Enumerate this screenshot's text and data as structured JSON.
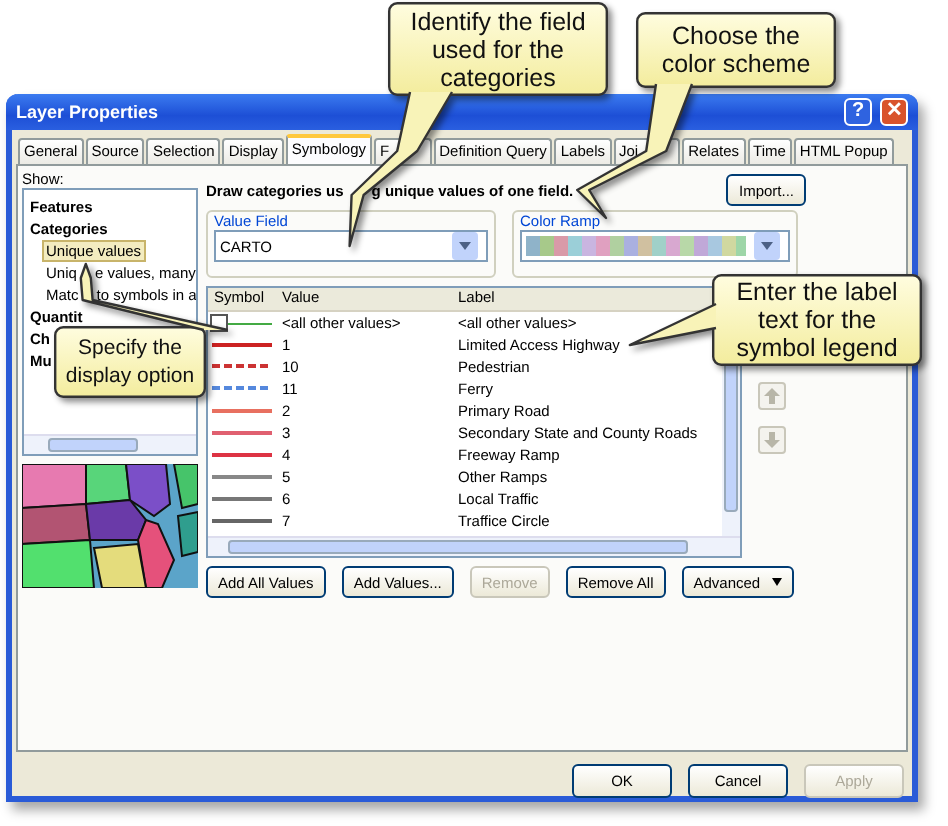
{
  "window": {
    "title": "Layer Properties",
    "help": "?",
    "close": "✕"
  },
  "tabs": [
    {
      "label": "General",
      "selected": false
    },
    {
      "label": "Source",
      "selected": false
    },
    {
      "label": "Selection",
      "selected": false
    },
    {
      "label": "Display",
      "selected": false
    },
    {
      "label": "Symbology",
      "selected": true
    },
    {
      "label": "F",
      "selected": false,
      "covered_by_callout": true
    },
    {
      "label": "Definition Query",
      "selected": false
    },
    {
      "label": "Labels",
      "selected": false
    },
    {
      "label": "Joi",
      "selected": false,
      "covered_by_callout": true
    },
    {
      "label": "Relates",
      "selected": false
    },
    {
      "label": "Time",
      "selected": false
    },
    {
      "label": "HTML Popup",
      "selected": false
    }
  ],
  "show": {
    "label": "Show:",
    "tree": [
      {
        "label": "Features",
        "selected": false
      },
      {
        "label": "Categories",
        "selected": false,
        "children": [
          {
            "label": "Unique values",
            "selected": true
          },
          {
            "label_parts": [
              "Uniq",
              "e values, many"
            ],
            "selected": false
          },
          {
            "label_parts": [
              "Matc",
              "to symbols in a"
            ],
            "selected": false
          }
        ]
      },
      {
        "label": "Quantit",
        "selected": false
      },
      {
        "label": "Ch",
        "selected": false
      },
      {
        "label": "Mu",
        "selected": false
      }
    ]
  },
  "description_parts": [
    "Draw categories us",
    "g unique values of one field."
  ],
  "import_button": "Import...",
  "value_field": {
    "legend": "Value Field",
    "value": "CARTO"
  },
  "color_ramp": {
    "legend": "Color Ramp"
  },
  "table": {
    "columns": [
      "Symbol",
      "Value",
      "Label"
    ],
    "rows": [
      {
        "kind": "default",
        "color": "#44aa44",
        "value": "<all other values>",
        "label": "<all other values>"
      },
      {
        "kind": "solid",
        "color": "#cc2222",
        "value": "1",
        "label": "Limited Access Highway"
      },
      {
        "kind": "dashed",
        "color": "#cc3333",
        "value": "10",
        "label": "Pedestrian"
      },
      {
        "kind": "dashed",
        "color": "#5588dd",
        "value": "11",
        "label": "Ferry"
      },
      {
        "kind": "solid",
        "color": "#e87060",
        "value": "2",
        "label": "Primary Road"
      },
      {
        "kind": "solid",
        "color": "#e06070",
        "value": "3",
        "label": "Secondary State and County Roads"
      },
      {
        "kind": "solid",
        "color": "#dd3344",
        "value": "4",
        "label": "Freeway Ramp"
      },
      {
        "kind": "solid",
        "color": "#888888",
        "value": "5",
        "label": "Other Ramps"
      },
      {
        "kind": "solid",
        "color": "#777777",
        "value": "6",
        "label": "Local Traffic"
      },
      {
        "kind": "solid",
        "color": "#666666",
        "value": "7",
        "label": "Traffice Circle"
      }
    ]
  },
  "buttons": [
    {
      "label": "Add All Values",
      "disabled": false
    },
    {
      "label": "Add Values...",
      "disabled": false
    },
    {
      "label": "Remove",
      "disabled": true
    },
    {
      "label": "Remove All",
      "disabled": false
    },
    {
      "label": "Advanced",
      "disabled": false,
      "menu": true
    }
  ],
  "dialog_buttons": [
    {
      "label": "OK",
      "disabled": false
    },
    {
      "label": "Cancel",
      "disabled": false
    },
    {
      "label": "Apply",
      "disabled": true
    }
  ],
  "callouts": [
    {
      "text": "Identify the field used for the categories"
    },
    {
      "text": "Choose the color scheme"
    },
    {
      "text": "Specify the display option"
    },
    {
      "text": "Enter the label text for the symbol legend"
    }
  ]
}
